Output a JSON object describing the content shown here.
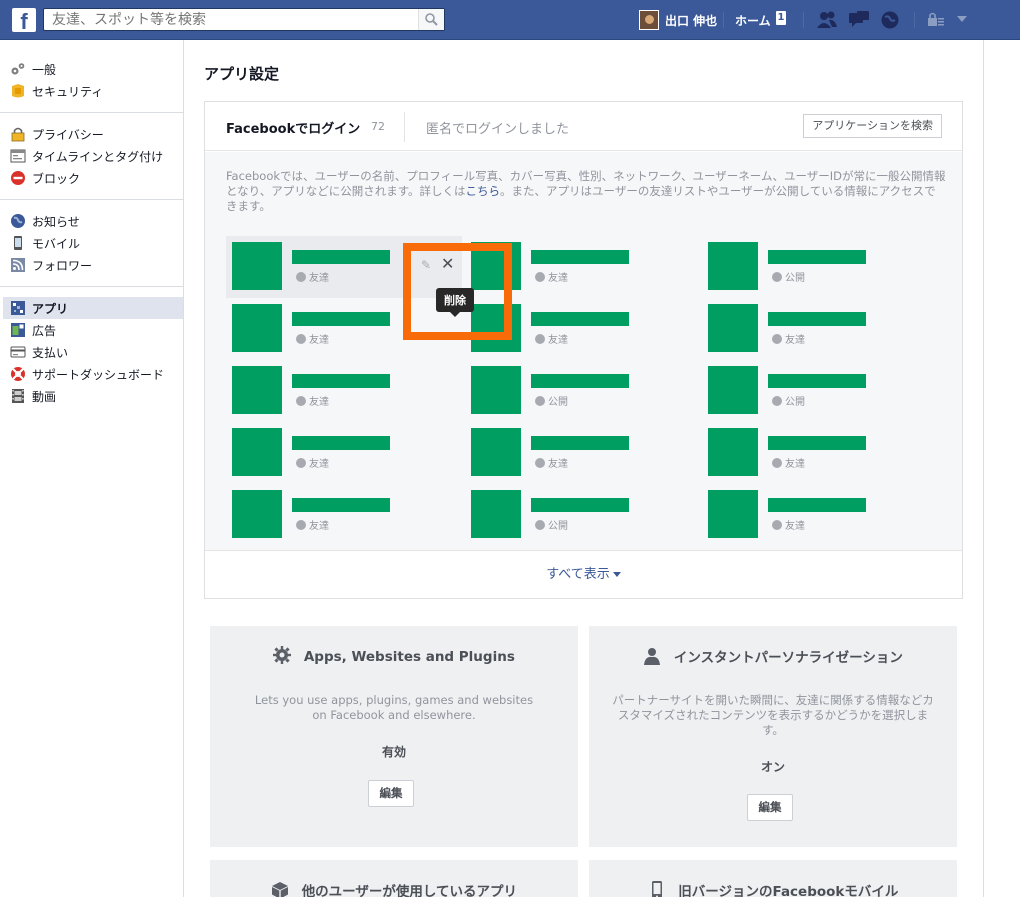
{
  "topbar": {
    "logo": "f",
    "search_placeholder": "友達、スポット等を検索",
    "user_name": "出口 伸也",
    "home_label": "ホーム",
    "home_count": "1",
    "brand_color": "#3b5998"
  },
  "leftnav": {
    "groups": [
      [
        {
          "label": "一般",
          "icon": "gears-icon"
        },
        {
          "label": "セキュリティ",
          "icon": "badge-icon"
        }
      ],
      [
        {
          "label": "プライバシー",
          "icon": "lock-icon"
        },
        {
          "label": "タイムラインとタグ付け",
          "icon": "timeline-icon"
        },
        {
          "label": "ブロック",
          "icon": "block-icon"
        }
      ],
      [
        {
          "label": "お知らせ",
          "icon": "globe-icon"
        },
        {
          "label": "モバイル",
          "icon": "mobile-icon"
        },
        {
          "label": "フォロワー",
          "icon": "rss-icon"
        }
      ],
      [
        {
          "label": "アプリ",
          "icon": "apps-icon"
        },
        {
          "label": "広告",
          "icon": "ads-icon"
        },
        {
          "label": "支払い",
          "icon": "card-icon"
        },
        {
          "label": "サポートダッシュボード",
          "icon": "lifebuoy-icon"
        },
        {
          "label": "動画",
          "icon": "film-icon"
        }
      ]
    ]
  },
  "main": {
    "page_title": "アプリ設定",
    "tabs": {
      "login_label": "Facebookでログイン",
      "login_count": "72",
      "anon_label": "匿名でログインしました",
      "search_button": "アプリケーションを検索"
    },
    "description_part1": "Facebookでは、ユーザーの名前、プロフィール写真、カバー写真、性別、ネットワーク、ユーザーネーム、ユーザーIDが常に一般公開情報となり、アプリなどに公開されます。詳しくは",
    "description_link": "こちら",
    "description_part2": "。また、アプリはユーザーの友達リストやユーザーが公開している情報にアクセスできます。",
    "tooltip": "削除",
    "app_privacy": [
      [
        "友達",
        "友達",
        "公開"
      ],
      [
        "友達",
        "友達",
        "友達"
      ],
      [
        "友達",
        "公開",
        "公開"
      ],
      [
        "友達",
        "友達",
        "友達"
      ],
      [
        "友達",
        "公開",
        "友達"
      ]
    ],
    "show_all": "すべて表示",
    "accent_green": "#009e60",
    "highlight_color": "#f96a08"
  },
  "cards": [
    {
      "title": "Apps, Websites and Plugins",
      "icon": "gear-icon",
      "description": "Lets you use apps, plugins, games and websites on Facebook and elsewhere.",
      "status": "有効",
      "edit_label": "編集"
    },
    {
      "title": "インスタントパーソナライゼーション",
      "icon": "person-icon",
      "description": "パートナーサイトを開いた瞬間に、友達に関係する情報などカスタマイズされたコンテンツを表示するかどうかを選択します。",
      "status": "オン",
      "edit_label": "編集"
    },
    {
      "title": "他のユーザーが使用しているアプリ",
      "icon": "cube-icon"
    },
    {
      "title": "旧バージョンのFacebookモバイル",
      "icon": "phone-icon"
    }
  ]
}
